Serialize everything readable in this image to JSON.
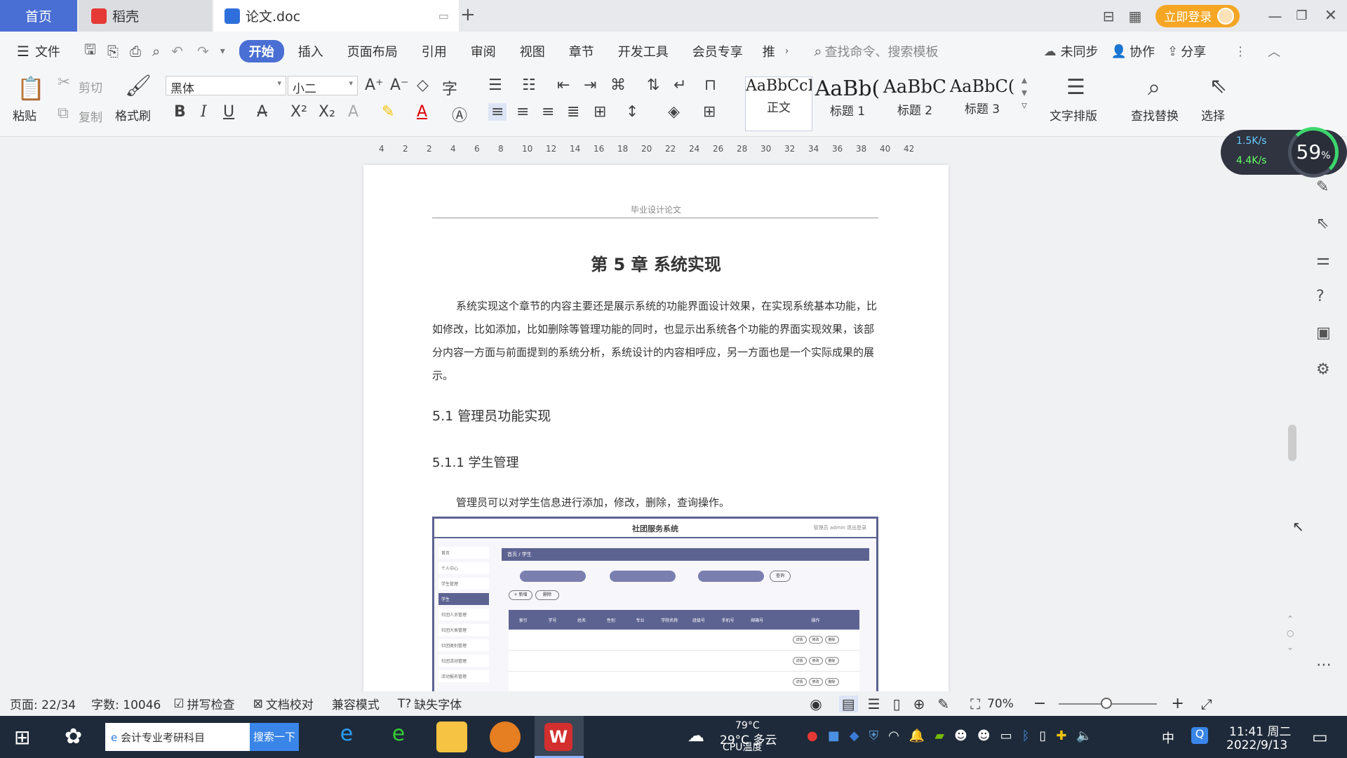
{
  "tabs": {
    "home": "首页",
    "daoke": "稻壳",
    "doc": "论文.doc"
  },
  "titlebar": {
    "login": "立即登录"
  },
  "menu": {
    "file": "文件",
    "items": [
      "开始",
      "插入",
      "页面布局",
      "引用",
      "审阅",
      "视图",
      "章节",
      "开发工具",
      "会员专享",
      "推"
    ],
    "search_placeholder": "查找命令、搜索模板",
    "sync": "未同步",
    "collab": "协作",
    "share": "分享"
  },
  "ribbon": {
    "paste": "粘贴",
    "cut": "剪切",
    "copy": "复制",
    "format_painter": "格式刷",
    "font": "黑体",
    "size": "小二",
    "styles": [
      {
        "sample": "AaBbCcI",
        "name": "正文"
      },
      {
        "sample": "AaBb(",
        "name": "标题 1"
      },
      {
        "sample": "AaBbC",
        "name": "标题 2"
      },
      {
        "sample": "AaBbC(",
        "name": "标题 3"
      }
    ],
    "text_layout": "文字排版",
    "find_replace": "查找替换",
    "select": "选择"
  },
  "ruler": [
    "4",
    "2",
    "2",
    "4",
    "6",
    "8",
    "10",
    "12",
    "14",
    "16",
    "18",
    "20",
    "22",
    "24",
    "26",
    "28",
    "30",
    "32",
    "34",
    "36",
    "38",
    "40",
    "42"
  ],
  "speed": {
    "up": "1.5K/s",
    "down": "4.4K/s",
    "percent": "59",
    "unit": "%"
  },
  "doc": {
    "header": "毕业设计论文",
    "chapter": "第 5 章  系统实现",
    "para1": "系统实现这个章节的内容主要还是展示系统的功能界面设计效果，在实现系统基本功能，比如修改，比如添加，比如删除等管理功能的同时，也显示出系统各个功能的界面实现效果，该部分内容一方面与前面提到的系统分析，系统设计的内容相呼应，另一方面也是一个实际成果的展示。",
    "h51": "5.1 管理员功能实现",
    "h511": "5.1.1  学生管理",
    "para2": "管理员可以对学生信息进行添加，修改，删除，查询操作。",
    "screenshot": {
      "title": "社团服务系统",
      "user": "管理员 admin    退出登录",
      "menu": [
        "首页",
        "个人中心",
        "学生管理",
        "学生",
        "社团人员管理",
        "社团大类管理",
        "社团类别管理",
        "社团活动管理",
        "活动报名管理"
      ],
      "crumb": "首页 / 学生",
      "cols": [
        "索引",
        "学号",
        "姓名",
        "性别",
        "专业",
        "学院名称",
        "班级号",
        "手机号",
        "邮箱号",
        "操作"
      ],
      "btn_add": "+ 新增",
      "btn_del": "删除",
      "btn_search": "查询",
      "actions": [
        "详情",
        "修改",
        "删除"
      ]
    }
  },
  "status": {
    "page": "页面: 22/34",
    "words": "字数: 10046",
    "spell": "拼写检查",
    "proof": "文档校对",
    "compat": "兼容模式",
    "missing_font": "缺失字体",
    "zoom": "70%"
  },
  "taskbar": {
    "search_text": "会计专业考研科目",
    "search_btn": "搜索一下",
    "weather": "29°C 多云",
    "cpu": "79°C",
    "cpu_label": "CPU温度",
    "ime": "中",
    "time": "11:41 周二",
    "date": "2022/9/13"
  }
}
